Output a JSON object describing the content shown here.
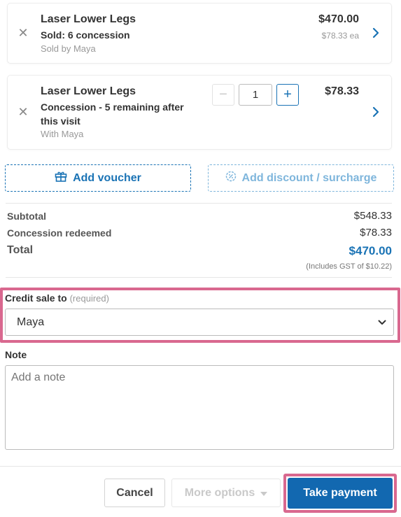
{
  "items": [
    {
      "title": "Laser Lower Legs",
      "subtitle": "Sold: 6 concession",
      "staff": "Sold by Maya",
      "price": "$470.00",
      "unit_price": "$78.33 ea"
    },
    {
      "title": "Laser Lower Legs",
      "subtitle_line1": "Concession - 5 remaining after",
      "subtitle_line2": "this visit",
      "staff": "With Maya",
      "quantity": "1",
      "price": "$78.33"
    }
  ],
  "actions": {
    "add_voucher": "Add voucher",
    "add_discount": "Add discount / surcharge"
  },
  "summary": {
    "subtotal_label": "Subtotal",
    "subtotal_value": "$548.33",
    "concession_label": "Concession redeemed",
    "concession_value": "$78.33",
    "total_label": "Total",
    "total_value": "$470.00",
    "gst_note": "(Includes GST of $10.22)"
  },
  "credit_sale": {
    "label": "Credit sale to",
    "required_hint": "(required)",
    "selected": "Maya"
  },
  "note": {
    "label": "Note",
    "placeholder": "Add a note"
  },
  "footer": {
    "cancel": "Cancel",
    "more_options": "More options",
    "take_payment": "Take payment"
  },
  "colors": {
    "accent": "#1a73b5",
    "highlight": "#d9688f",
    "primary_button": "#1268b0"
  }
}
